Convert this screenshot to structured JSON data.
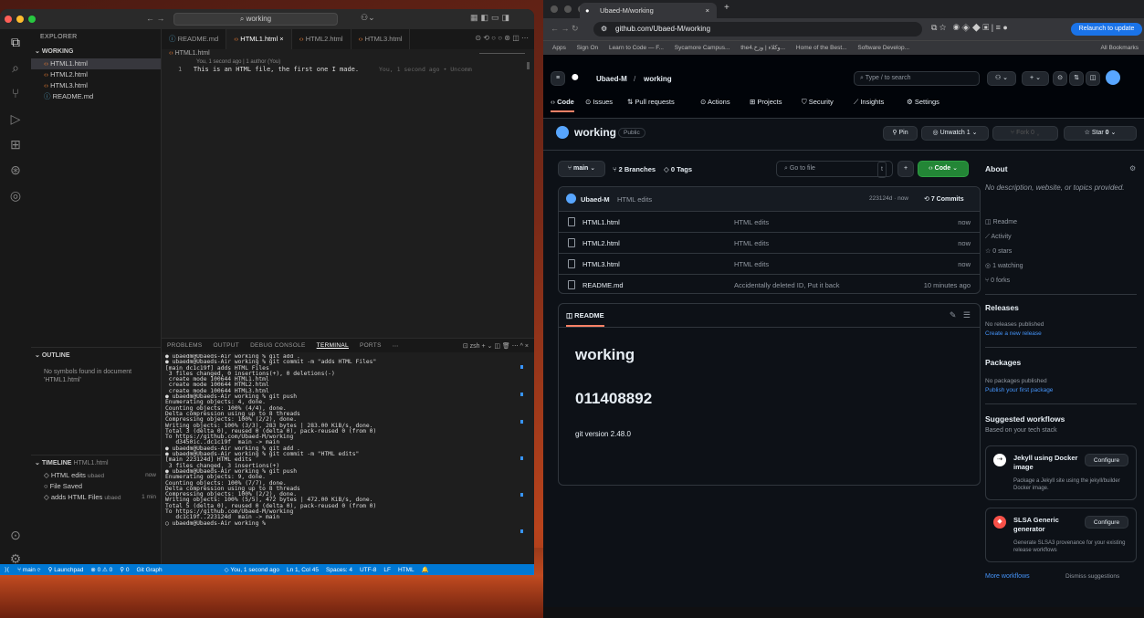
{
  "vscode": {
    "search": "working",
    "explorer_title": "EXPLORER",
    "folder": "WORKING",
    "files": [
      "HTML1.html",
      "HTML2.html",
      "HTML3.html",
      "README.md"
    ],
    "tabs": [
      "README.md",
      "HTML1.html",
      "HTML2.html",
      "HTML3.html"
    ],
    "breadcrumb": "HTML1.html",
    "blame": "You, 1 second ago | 1 author (You)",
    "line_number": "1",
    "line_text": "This is an HTML file, the first one I made.",
    "line_ghost": "You, 1 second ago • Uncomm",
    "outline_title": "OUTLINE",
    "outline_empty": "No symbols found in document 'HTML1.html'",
    "timeline_title": "TIMELINE",
    "timeline_file": "HTML1.html",
    "timeline": [
      {
        "label": "HTML edits",
        "author": "ubaed",
        "time": "now"
      },
      {
        "label": "File Saved",
        "author": "",
        "time": ""
      },
      {
        "label": "adds HTML Files",
        "author": "ubaed",
        "time": "1 min"
      }
    ],
    "panel_tabs": [
      "PROBLEMS",
      "OUTPUT",
      "DEBUG CONSOLE",
      "TERMINAL",
      "PORTS"
    ],
    "shell": "zsh",
    "terminal": "● ubaedm@Ubaeds-Air working % git add .\n● ubaedm@Ubaeds-Air working % git commit -m \"adds HTML Files\"\n[main dc1c19f] adds HTML Files\n 3 files changed, 0 insertions(+), 0 deletions(-)\n create mode 100644 HTML1.html\n create mode 100644 HTML2.html\n create mode 100644 HTML3.html\n● ubaedm@Ubaeds-Air working % git push\nEnumerating objects: 4, done.\nCounting objects: 100% (4/4), done.\nDelta compression using up to 8 threads\nCompressing objects: 100% (2/2), done.\nWriting objects: 100% (3/3), 283 bytes | 283.00 KiB/s, done.\nTotal 3 (delta 0), reused 0 (delta 0), pack-reused 0 (from 0)\nTo https://github.com/Ubaed-M/working\n   d3450ic..dc1c19f  main -> main\n● ubaedm@Ubaeds-Air working % git add .\n● ubaedm@Ubaeds-Air working % git commit -m \"HTML edits\"\n[main 223124d] HTML edits\n 3 files changed, 3 insertions(+)\n● ubaedm@Ubaeds-Air working % git push\nEnumerating objects: 9, done.\nCounting objects: 100% (7/7), done.\nDelta compression using up to 8 threads\nCompressing objects: 100% (2/2), done.\nWriting objects: 100% (5/5), 472 bytes | 472.00 KiB/s, done.\nTotal 5 (delta 0), reused 0 (delta 0), pack-reused 0 (from 0)\nTo https://github.com/Ubaed-M/working\n   dc1c19f..223124d  main -> main\n○ ubaedm@Ubaeds-Air working % ",
    "status": {
      "branch": "main",
      "launchpad": "Launchpad",
      "problems": "⊗ 0 ⚠ 0",
      "ports": "⚲ 0",
      "git_graph": "Git Graph",
      "blame": "You, 1 second ago",
      "position": "Ln 1, Col 45",
      "spaces": "Spaces: 4",
      "encoding": "UTF-8",
      "eol": "LF",
      "lang": "HTML"
    }
  },
  "chrome": {
    "tab_title": "Ubaed-M/working",
    "url": "github.com/Ubaed-M/working",
    "relaunch": "Relaunch to update",
    "bookmarks": [
      "Apps",
      "Sign On",
      "Learn to Code — F...",
      "Sycamore Campus...",
      "the4.وكلاء | وزخ...",
      "Home of the Best...",
      "Software Develop...",
      "All Bookmarks"
    ]
  },
  "github": {
    "owner": "Ubaed-M",
    "repo": "working",
    "search_placeholder": "Type / to search",
    "nav": [
      "Code",
      "Issues",
      "Pull requests",
      "Actions",
      "Projects",
      "Security",
      "Insights",
      "Settings"
    ],
    "visibility": "Public",
    "pin": "Pin",
    "unwatch": "Unwatch",
    "watch_count": "1",
    "fork": "Fork",
    "fork_count": "0",
    "star": "Star",
    "star_count": "0",
    "branch": "main",
    "branches": "2 Branches",
    "tags": "0 Tags",
    "goto_file": "Go to file",
    "goto_key": "t",
    "code_button": "Code",
    "commit_author": "Ubaed-M",
    "commit_msg": "HTML edits",
    "commit_meta": "223124d · now",
    "commits": "7 Commits",
    "files": [
      {
        "name": "HTML1.html",
        "msg": "HTML edits",
        "time": "now"
      },
      {
        "name": "HTML2.html",
        "msg": "HTML edits",
        "time": "now"
      },
      {
        "name": "HTML3.html",
        "msg": "HTML edits",
        "time": "now"
      },
      {
        "name": "README.md",
        "msg": "Accidentally deleted ID, Put it back",
        "time": "10 minutes ago"
      }
    ],
    "readme_label": "README",
    "readme_h1": "working",
    "readme_h2": "011408892",
    "readme_p": "git version 2.48.0",
    "about_title": "About",
    "about_desc": "No description, website, or topics provided.",
    "about_items": [
      "Readme",
      "Activity",
      "0 stars",
      "1 watching",
      "0 forks"
    ],
    "releases_title": "Releases",
    "releases_none": "No releases published",
    "releases_link": "Create a new release",
    "packages_title": "Packages",
    "packages_none": "No packages published",
    "packages_link": "Publish your first package",
    "workflows_title": "Suggested workflows",
    "workflows_sub": "Based on your tech stack",
    "wf1_title": "Jekyll using Docker image",
    "wf1_desc": "Package a Jekyll site using the jekyll/builder Docker image.",
    "wf2_title": "SLSA Generic generator",
    "wf2_desc": "Generate SLSA3 provenance for your existing release workflows",
    "configure": "Configure",
    "more_workflows": "More workflows",
    "dismiss": "Dismiss suggestions"
  }
}
